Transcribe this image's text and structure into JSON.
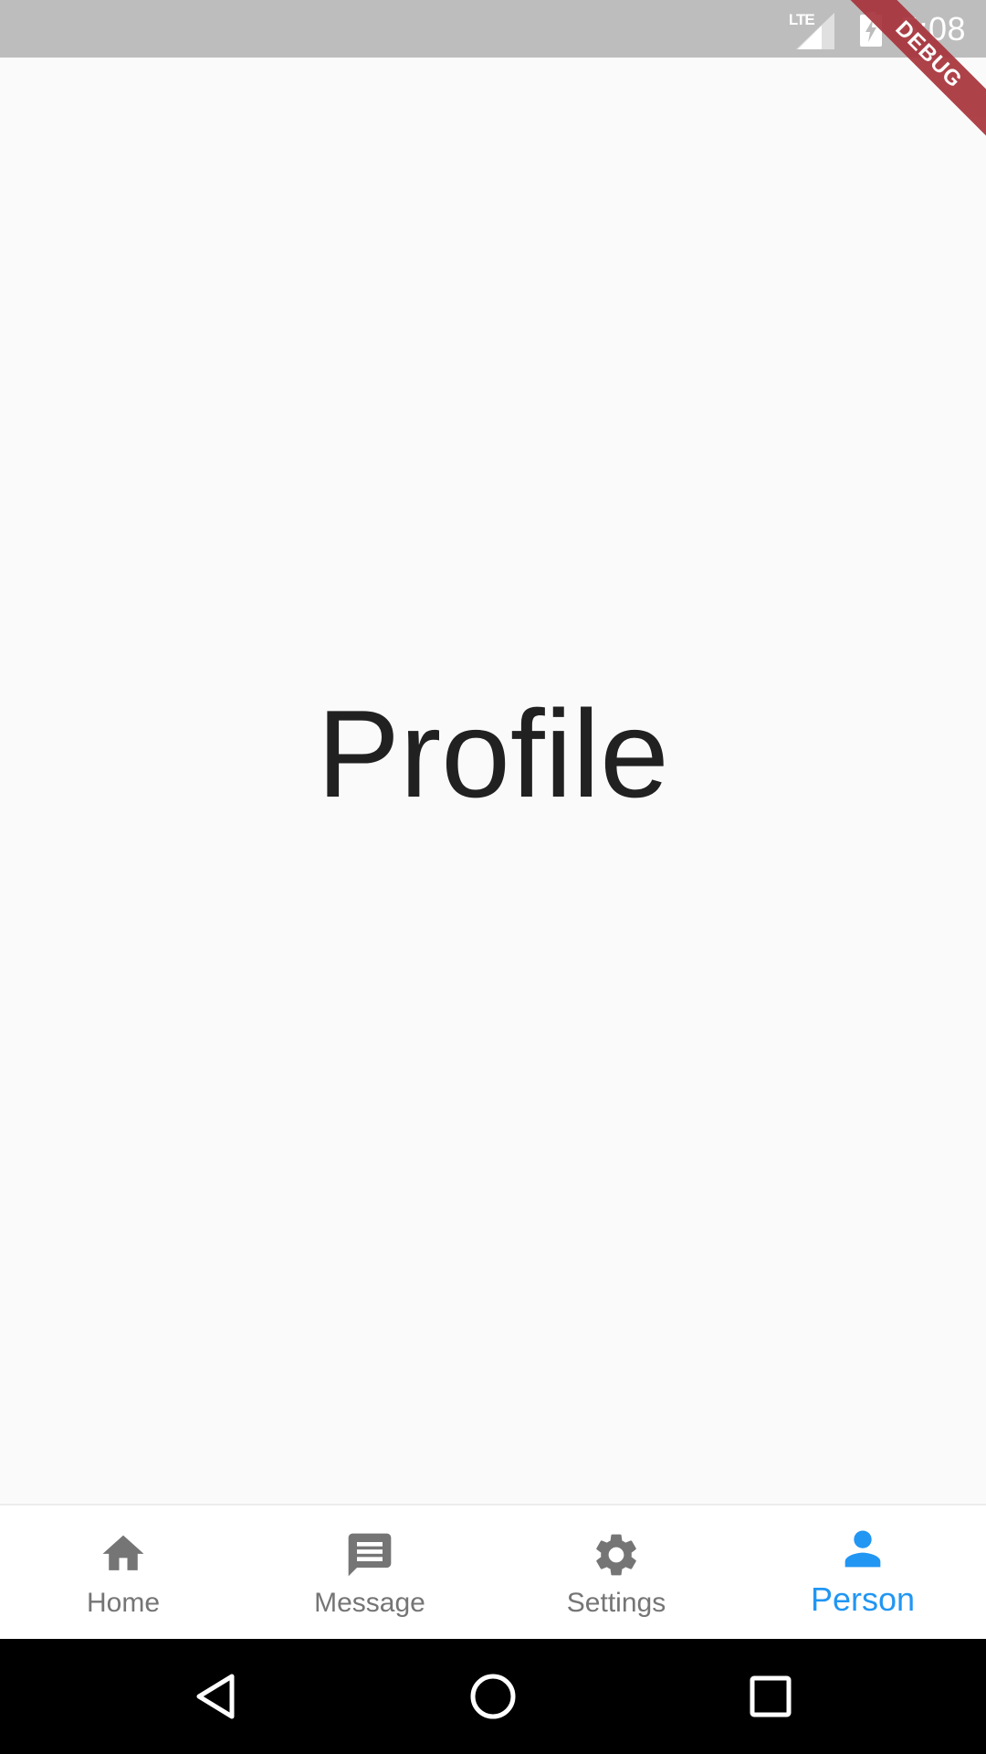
{
  "status_bar": {
    "network_label": "LTE",
    "time": "5:08",
    "icons": [
      "signal-icon",
      "battery-charging-icon"
    ]
  },
  "debug_banner": {
    "label": "DEBUG",
    "color": "#a8333b"
  },
  "main": {
    "title": "Profile"
  },
  "bottom_nav": {
    "active_color": "#2196f3",
    "inactive_color": "#757575",
    "items": [
      {
        "label": "Home",
        "icon": "home-icon",
        "active": false
      },
      {
        "label": "Message",
        "icon": "message-icon",
        "active": false
      },
      {
        "label": "Settings",
        "icon": "settings-gear-icon",
        "active": false
      },
      {
        "label": "Person",
        "icon": "person-icon",
        "active": true
      }
    ]
  },
  "system_nav": {
    "buttons": [
      "back-icon",
      "home-circle-icon",
      "recents-square-icon"
    ]
  }
}
